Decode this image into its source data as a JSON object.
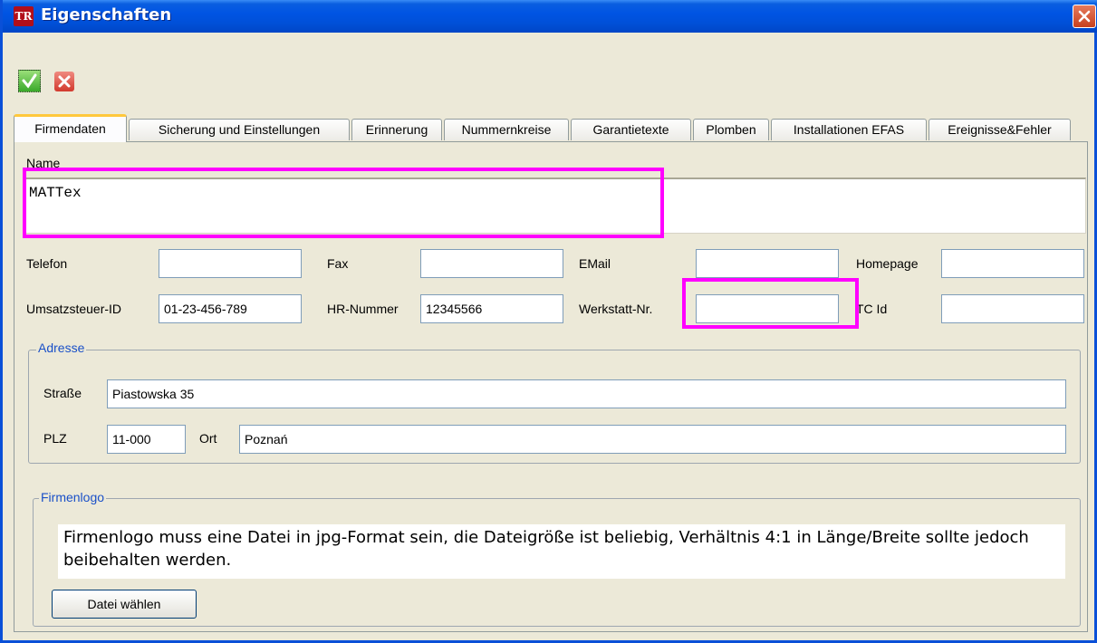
{
  "window": {
    "title": "Eigenschaften",
    "app_icon_text": "TR"
  },
  "tabs": [
    {
      "label": "Firmendaten"
    },
    {
      "label": "Sicherung und Einstellungen"
    },
    {
      "label": "Erinnerung"
    },
    {
      "label": "Nummernkreise"
    },
    {
      "label": "Garantietexte"
    },
    {
      "label": "Plomben"
    },
    {
      "label": "Installationen EFAS"
    },
    {
      "label": "Ereignisse&Fehler"
    }
  ],
  "form": {
    "name_label": "Name",
    "name_value": "MATTex",
    "telefon_label": "Telefon",
    "telefon_value": "",
    "fax_label": "Fax",
    "fax_value": "",
    "email_label": "EMail",
    "email_value": "",
    "homepage_label": "Homepage",
    "homepage_value": "",
    "ust_label": "Umsatzsteuer-ID",
    "ust_value": "01-23-456-789",
    "hr_label": "HR-Nummer",
    "hr_value": "12345566",
    "werkstatt_label": "Werkstatt-Nr.",
    "werkstatt_value": "",
    "tcid_label": "TC Id",
    "tcid_value": ""
  },
  "address": {
    "legend": "Adresse",
    "strasse_label": "Straße",
    "strasse_value": "Piastowska 35",
    "plz_label": "PLZ",
    "plz_value": "11-000",
    "ort_label": "Ort",
    "ort_value": "Poznań"
  },
  "logo": {
    "legend": "Firmenlogo",
    "note": "Firmenlogo muss eine Datei in jpg-Format sein, die Dateigröße ist beliebig, Verhältnis 4:1 in Länge/Breite sollte jedoch beibehalten werden.",
    "button_label": "Datei wählen"
  },
  "colors": {
    "highlight": "#ff00ff",
    "titlebar": "#0054e3",
    "legend": "#1a50c8"
  }
}
